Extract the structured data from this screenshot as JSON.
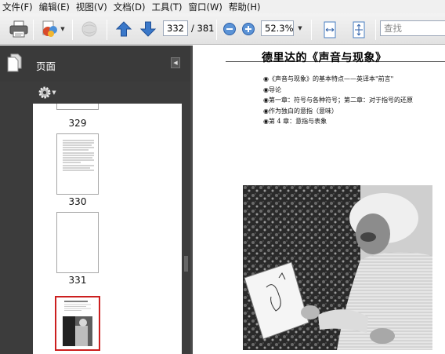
{
  "menu": [
    "文件(F)",
    "编辑(E)",
    "视图(V)",
    "文档(D)",
    "工具(T)",
    "窗口(W)",
    "帮助(H)"
  ],
  "toolbar": {
    "current_page": "332",
    "page_total": "/ 381",
    "zoom": "52.3%",
    "search_placeholder": "查找"
  },
  "panel": {
    "title": "页面",
    "thumbnails": [
      "329",
      "330",
      "331"
    ]
  },
  "document": {
    "heading": "德里达的《声音与现象》",
    "bullets": [
      "◉《声音与现象》的基本特点——英译本\"前言\"",
      "◉导论",
      "◉第一章：符号与各种符号；第二章：对于指号的还原",
      "◉作为独白的意指（意味）",
      "◉第 4 章：意指与表象"
    ]
  },
  "colors": {
    "selection": "#cc1f1f",
    "toolbar_blue": "#3a78c9",
    "panel_dark": "#3c3c3c"
  }
}
